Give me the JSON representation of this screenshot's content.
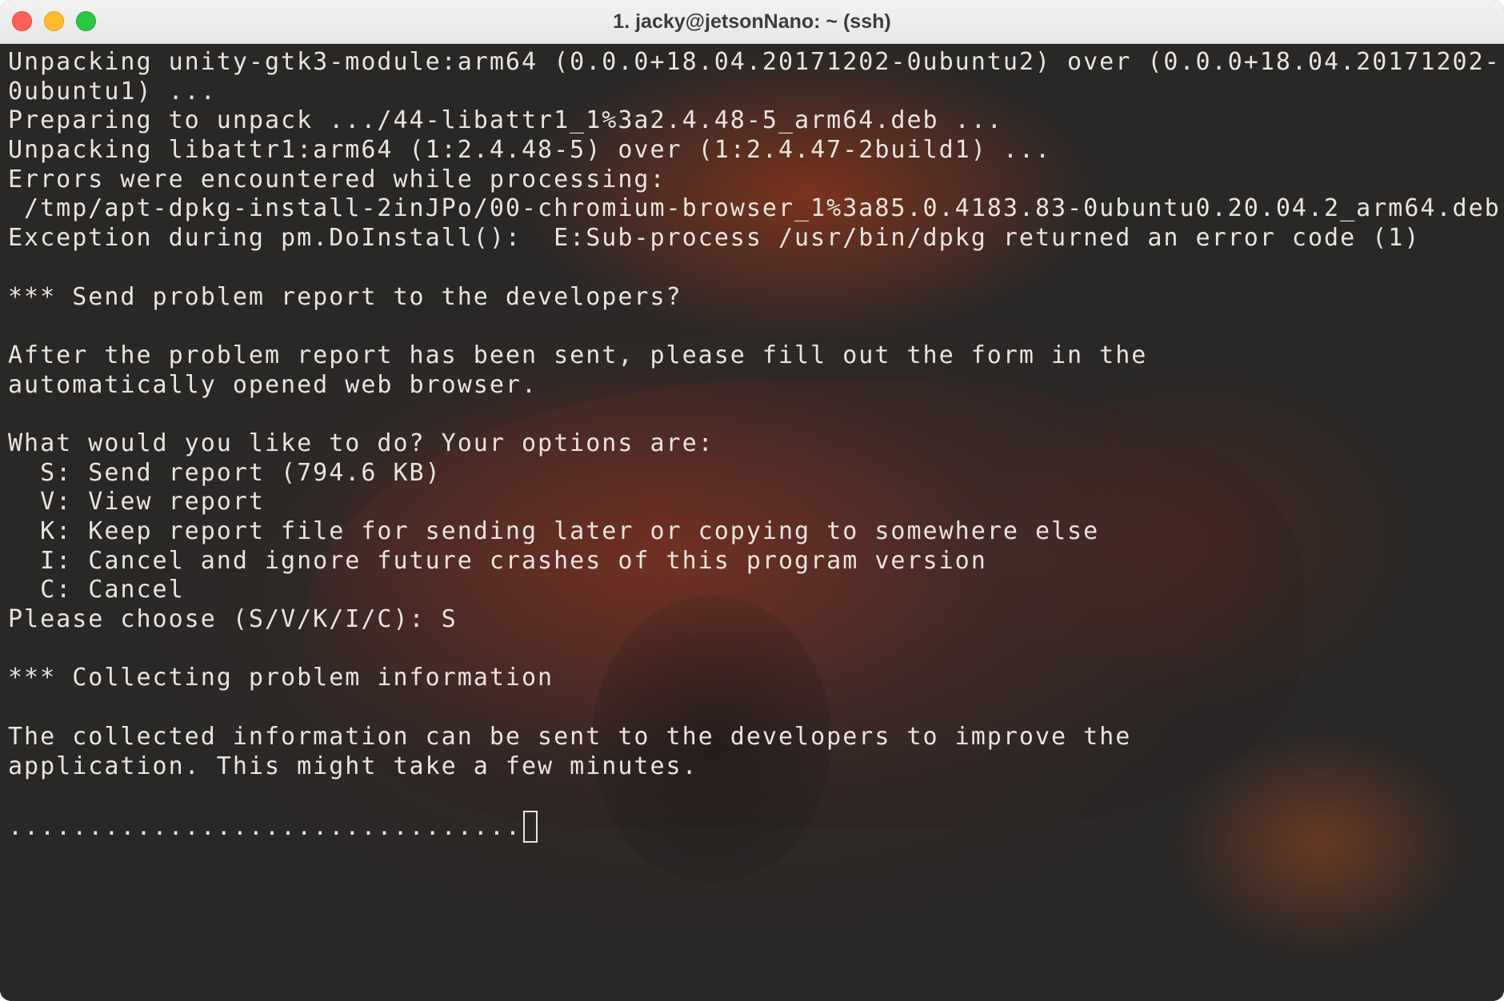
{
  "window": {
    "title": "1. jacky@jetsonNano: ~ (ssh)",
    "traffic_lights": {
      "close_color": "#fe5f57",
      "minimize_color": "#febc2e",
      "zoom_color": "#28c840"
    }
  },
  "terminal": {
    "text_color": "#e8e4e0",
    "lines": [
      "Unpacking unity-gtk3-module:arm64 (0.0.0+18.04.20171202-0ubuntu2) over (0.0.0+18.04.20171202-",
      "0ubuntu1) ...",
      "Preparing to unpack .../44-libattr1_1%3a2.4.48-5_arm64.deb ...",
      "Unpacking libattr1:arm64 (1:2.4.48-5) over (1:2.4.47-2build1) ...",
      "Errors were encountered while processing:",
      " /tmp/apt-dpkg-install-2inJPo/00-chromium-browser_1%3a85.0.4183.83-0ubuntu0.20.04.2_arm64.deb",
      "Exception during pm.DoInstall():  E:Sub-process /usr/bin/dpkg returned an error code (1)",
      "",
      "*** Send problem report to the developers?",
      "",
      "After the problem report has been sent, please fill out the form in the",
      "automatically opened web browser.",
      "",
      "What would you like to do? Your options are:",
      "  S: Send report (794.6 KB)",
      "  V: View report",
      "  K: Keep report file for sending later or copying to somewhere else",
      "  I: Cancel and ignore future crashes of this program version",
      "  C: Cancel",
      "Please choose (S/V/K/I/C): S",
      "",
      "*** Collecting problem information",
      "",
      "The collected information can be sent to the developers to improve the",
      "application. This might take a few minutes.",
      "",
      "................................"
    ]
  }
}
